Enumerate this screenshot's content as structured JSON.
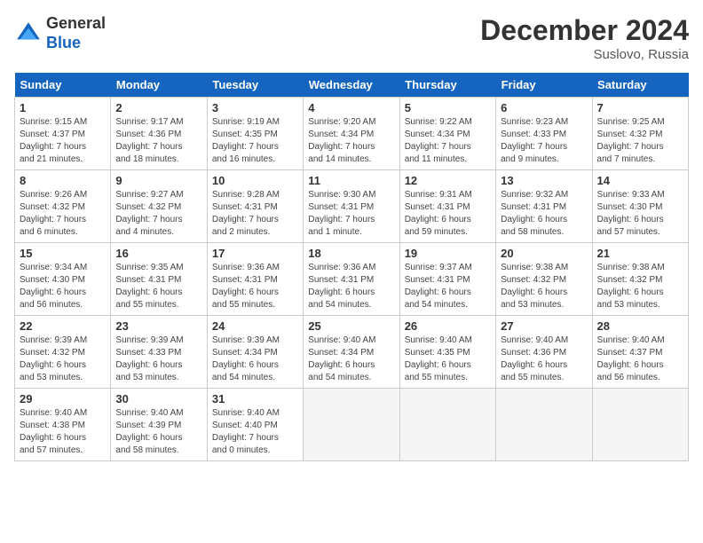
{
  "header": {
    "logo_line1": "General",
    "logo_line2": "Blue",
    "month": "December 2024",
    "location": "Suslovo, Russia"
  },
  "weekdays": [
    "Sunday",
    "Monday",
    "Tuesday",
    "Wednesday",
    "Thursday",
    "Friday",
    "Saturday"
  ],
  "weeks": [
    [
      {
        "day": "1",
        "info": "Sunrise: 9:15 AM\nSunset: 4:37 PM\nDaylight: 7 hours\nand 21 minutes."
      },
      {
        "day": "2",
        "info": "Sunrise: 9:17 AM\nSunset: 4:36 PM\nDaylight: 7 hours\nand 18 minutes."
      },
      {
        "day": "3",
        "info": "Sunrise: 9:19 AM\nSunset: 4:35 PM\nDaylight: 7 hours\nand 16 minutes."
      },
      {
        "day": "4",
        "info": "Sunrise: 9:20 AM\nSunset: 4:34 PM\nDaylight: 7 hours\nand 14 minutes."
      },
      {
        "day": "5",
        "info": "Sunrise: 9:22 AM\nSunset: 4:34 PM\nDaylight: 7 hours\nand 11 minutes."
      },
      {
        "day": "6",
        "info": "Sunrise: 9:23 AM\nSunset: 4:33 PM\nDaylight: 7 hours\nand 9 minutes."
      },
      {
        "day": "7",
        "info": "Sunrise: 9:25 AM\nSunset: 4:32 PM\nDaylight: 7 hours\nand 7 minutes."
      }
    ],
    [
      {
        "day": "8",
        "info": "Sunrise: 9:26 AM\nSunset: 4:32 PM\nDaylight: 7 hours\nand 6 minutes."
      },
      {
        "day": "9",
        "info": "Sunrise: 9:27 AM\nSunset: 4:32 PM\nDaylight: 7 hours\nand 4 minutes."
      },
      {
        "day": "10",
        "info": "Sunrise: 9:28 AM\nSunset: 4:31 PM\nDaylight: 7 hours\nand 2 minutes."
      },
      {
        "day": "11",
        "info": "Sunrise: 9:30 AM\nSunset: 4:31 PM\nDaylight: 7 hours\nand 1 minute."
      },
      {
        "day": "12",
        "info": "Sunrise: 9:31 AM\nSunset: 4:31 PM\nDaylight: 6 hours\nand 59 minutes."
      },
      {
        "day": "13",
        "info": "Sunrise: 9:32 AM\nSunset: 4:31 PM\nDaylight: 6 hours\nand 58 minutes."
      },
      {
        "day": "14",
        "info": "Sunrise: 9:33 AM\nSunset: 4:30 PM\nDaylight: 6 hours\nand 57 minutes."
      }
    ],
    [
      {
        "day": "15",
        "info": "Sunrise: 9:34 AM\nSunset: 4:30 PM\nDaylight: 6 hours\nand 56 minutes."
      },
      {
        "day": "16",
        "info": "Sunrise: 9:35 AM\nSunset: 4:31 PM\nDaylight: 6 hours\nand 55 minutes."
      },
      {
        "day": "17",
        "info": "Sunrise: 9:36 AM\nSunset: 4:31 PM\nDaylight: 6 hours\nand 55 minutes."
      },
      {
        "day": "18",
        "info": "Sunrise: 9:36 AM\nSunset: 4:31 PM\nDaylight: 6 hours\nand 54 minutes."
      },
      {
        "day": "19",
        "info": "Sunrise: 9:37 AM\nSunset: 4:31 PM\nDaylight: 6 hours\nand 54 minutes."
      },
      {
        "day": "20",
        "info": "Sunrise: 9:38 AM\nSunset: 4:32 PM\nDaylight: 6 hours\nand 53 minutes."
      },
      {
        "day": "21",
        "info": "Sunrise: 9:38 AM\nSunset: 4:32 PM\nDaylight: 6 hours\nand 53 minutes."
      }
    ],
    [
      {
        "day": "22",
        "info": "Sunrise: 9:39 AM\nSunset: 4:32 PM\nDaylight: 6 hours\nand 53 minutes."
      },
      {
        "day": "23",
        "info": "Sunrise: 9:39 AM\nSunset: 4:33 PM\nDaylight: 6 hours\nand 53 minutes."
      },
      {
        "day": "24",
        "info": "Sunrise: 9:39 AM\nSunset: 4:34 PM\nDaylight: 6 hours\nand 54 minutes."
      },
      {
        "day": "25",
        "info": "Sunrise: 9:40 AM\nSunset: 4:34 PM\nDaylight: 6 hours\nand 54 minutes."
      },
      {
        "day": "26",
        "info": "Sunrise: 9:40 AM\nSunset: 4:35 PM\nDaylight: 6 hours\nand 55 minutes."
      },
      {
        "day": "27",
        "info": "Sunrise: 9:40 AM\nSunset: 4:36 PM\nDaylight: 6 hours\nand 55 minutes."
      },
      {
        "day": "28",
        "info": "Sunrise: 9:40 AM\nSunset: 4:37 PM\nDaylight: 6 hours\nand 56 minutes."
      }
    ],
    [
      {
        "day": "29",
        "info": "Sunrise: 9:40 AM\nSunset: 4:38 PM\nDaylight: 6 hours\nand 57 minutes."
      },
      {
        "day": "30",
        "info": "Sunrise: 9:40 AM\nSunset: 4:39 PM\nDaylight: 6 hours\nand 58 minutes."
      },
      {
        "day": "31",
        "info": "Sunrise: 9:40 AM\nSunset: 4:40 PM\nDaylight: 7 hours\nand 0 minutes."
      },
      {
        "day": "",
        "info": ""
      },
      {
        "day": "",
        "info": ""
      },
      {
        "day": "",
        "info": ""
      },
      {
        "day": "",
        "info": ""
      }
    ]
  ]
}
